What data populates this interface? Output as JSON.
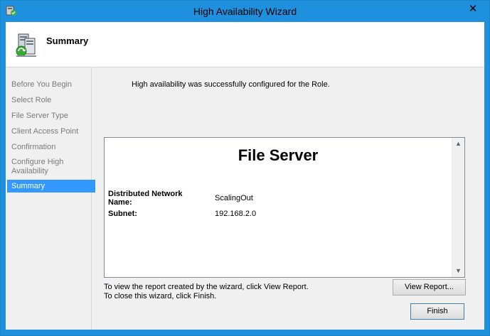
{
  "window": {
    "title": "High Availability Wizard",
    "close_glyph": "✕",
    "icon": "cluster-wizard-icon"
  },
  "header": {
    "title": "Summary",
    "icon": "server-cluster-icon"
  },
  "nav": {
    "items": [
      {
        "label": "Before You Begin"
      },
      {
        "label": "Select Role"
      },
      {
        "label": "File Server Type"
      },
      {
        "label": "Client Access Point"
      },
      {
        "label": "Confirmation"
      },
      {
        "label": "Configure High Availability"
      },
      {
        "label": "Summary"
      }
    ],
    "active": "Summary"
  },
  "main": {
    "success_message": "High availability was successfully configured for the Role.",
    "report": {
      "heading": "File Server",
      "rows": [
        {
          "label": "Distributed Network Name:",
          "value": "ScalingOut"
        },
        {
          "label": "Subnet:",
          "value": "192.168.2.0"
        }
      ]
    },
    "instructions": [
      "To view the report created by the wizard, click View Report.",
      "To close this wizard, click Finish."
    ],
    "view_report_label": "View Report...",
    "finish_label": "Finish"
  },
  "colors": {
    "accent": "#1e90dd",
    "selection": "#3399ff",
    "nav_text": "#7a7a7a"
  }
}
